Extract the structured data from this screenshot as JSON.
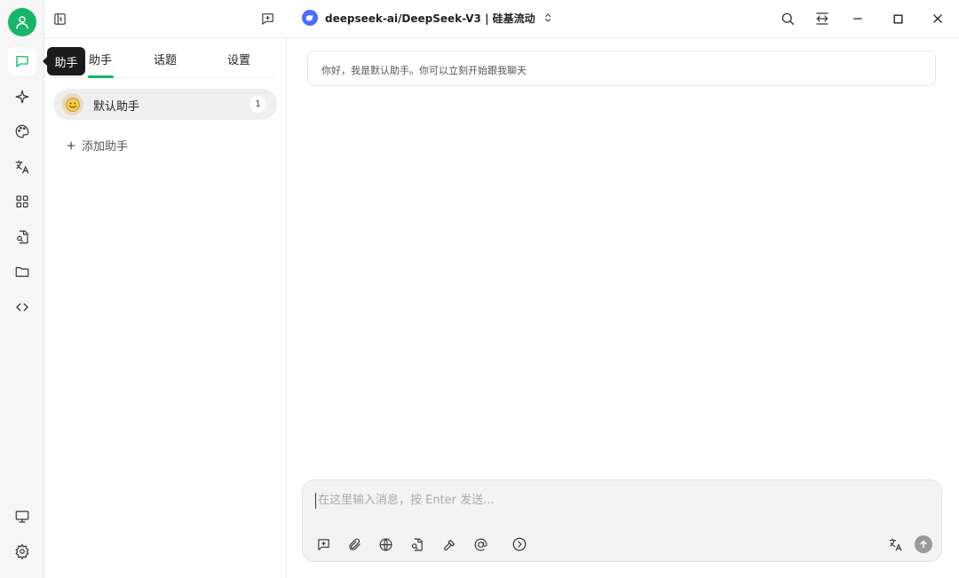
{
  "rail": {
    "tooltip": "助手",
    "items": [
      {
        "name": "chat-icon",
        "active": true
      },
      {
        "name": "sparkle-icon"
      },
      {
        "name": "palette-icon"
      },
      {
        "name": "translate-icon"
      },
      {
        "name": "apps-grid-icon"
      },
      {
        "name": "document-search-icon"
      },
      {
        "name": "folder-icon"
      },
      {
        "name": "code-icon"
      }
    ],
    "bottom": [
      {
        "name": "monitor-icon"
      },
      {
        "name": "settings-gear-icon"
      }
    ]
  },
  "topbar": {
    "model_label": "deepseek-ai/DeepSeek-V3 | 硅基流动"
  },
  "panel": {
    "tabs": [
      "助手",
      "话题",
      "设置"
    ],
    "active_tab": 0,
    "assistants": [
      {
        "name": "默认助手",
        "count": "1"
      }
    ],
    "add_label": "添加助手"
  },
  "chat": {
    "greeting": "你好，我是默认助手。你可以立刻开始跟我聊天",
    "input_placeholder": "在这里输入消息，按 Enter 发送..."
  },
  "colors": {
    "accent": "#18b468",
    "model_brand": "#4d6bfe"
  }
}
